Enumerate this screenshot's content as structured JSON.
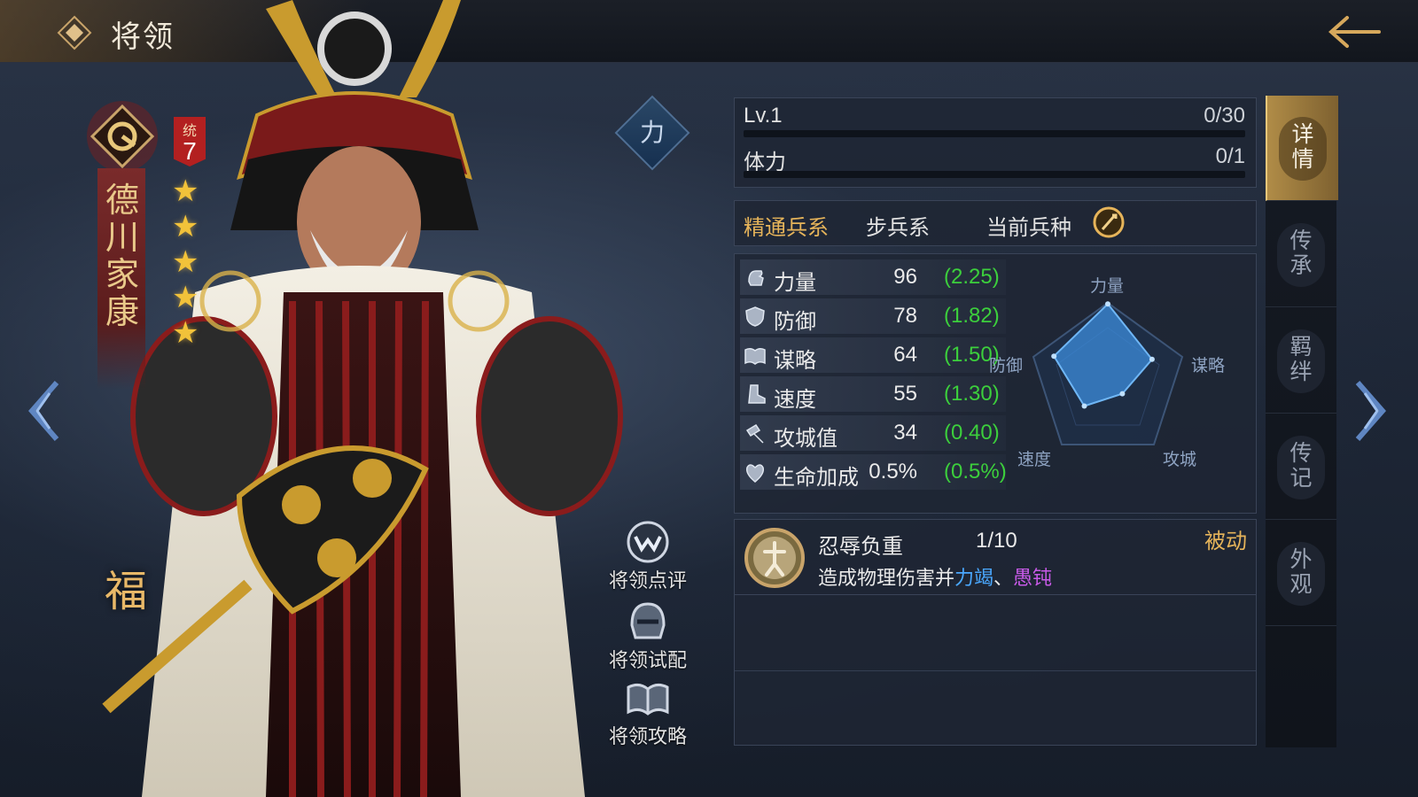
{
  "header": {
    "title": "将领"
  },
  "hero": {
    "name": "德川家康",
    "rank_label": "统",
    "rank_value": "7",
    "star_count": 5,
    "fortune_char": "福",
    "faction_char": "力"
  },
  "side_actions": [
    {
      "label": "将领点评",
      "icon": "review-icon"
    },
    {
      "label": "将领试配",
      "icon": "helmet-icon"
    },
    {
      "label": "将领攻略",
      "icon": "book-icon"
    }
  ],
  "level": {
    "label": "Lv.1",
    "value": "0/30",
    "progress": 0
  },
  "stamina": {
    "label": "体力",
    "value": "0/1",
    "progress": 0
  },
  "troop": {
    "mastery_label": "精通兵系",
    "mastery_value": "步兵系",
    "current_label": "当前兵种"
  },
  "stats": [
    {
      "name": "力量",
      "value": "96",
      "growth": "(2.25)",
      "icon": "fist-icon"
    },
    {
      "name": "防御",
      "value": "78",
      "growth": "(1.82)",
      "icon": "shield-icon"
    },
    {
      "name": "谋略",
      "value": "64",
      "growth": "(1.50)",
      "icon": "book-icon"
    },
    {
      "name": "速度",
      "value": "55",
      "growth": "(1.30)",
      "icon": "boot-icon"
    },
    {
      "name": "攻城值",
      "value": "34",
      "growth": "(0.40)",
      "icon": "hammer-icon"
    },
    {
      "name": "生命加成",
      "value": "0.5%",
      "growth": "(0.5%)",
      "icon": "heart-plus-icon"
    }
  ],
  "radar": {
    "labels": {
      "top": "力量",
      "right": "谋略",
      "bottom_right": "攻城",
      "bottom_left": "速度",
      "left": "防御"
    },
    "values": {
      "strength": 96,
      "strategy": 64,
      "siege": 34,
      "speed": 55,
      "defense": 78
    },
    "max": 100
  },
  "skill": {
    "name": "忍辱负重",
    "level": "1/10",
    "type": "被动",
    "desc_prefix": "造成物理伤害并",
    "effect1": "力竭",
    "separator": "、",
    "effect2": "愚钝"
  },
  "tabs": [
    {
      "label": "详情",
      "active": true
    },
    {
      "label": "传承",
      "active": false
    },
    {
      "label": "羁绊",
      "active": false
    },
    {
      "label": "传记",
      "active": false
    },
    {
      "label": "外观",
      "active": false
    }
  ],
  "colors": {
    "gold": "#e6b45a",
    "growth_green": "#3ccf3c",
    "effect_blue": "#4aa8ff",
    "effect_purple": "#c85ae8",
    "rank_red": "#b32020"
  }
}
